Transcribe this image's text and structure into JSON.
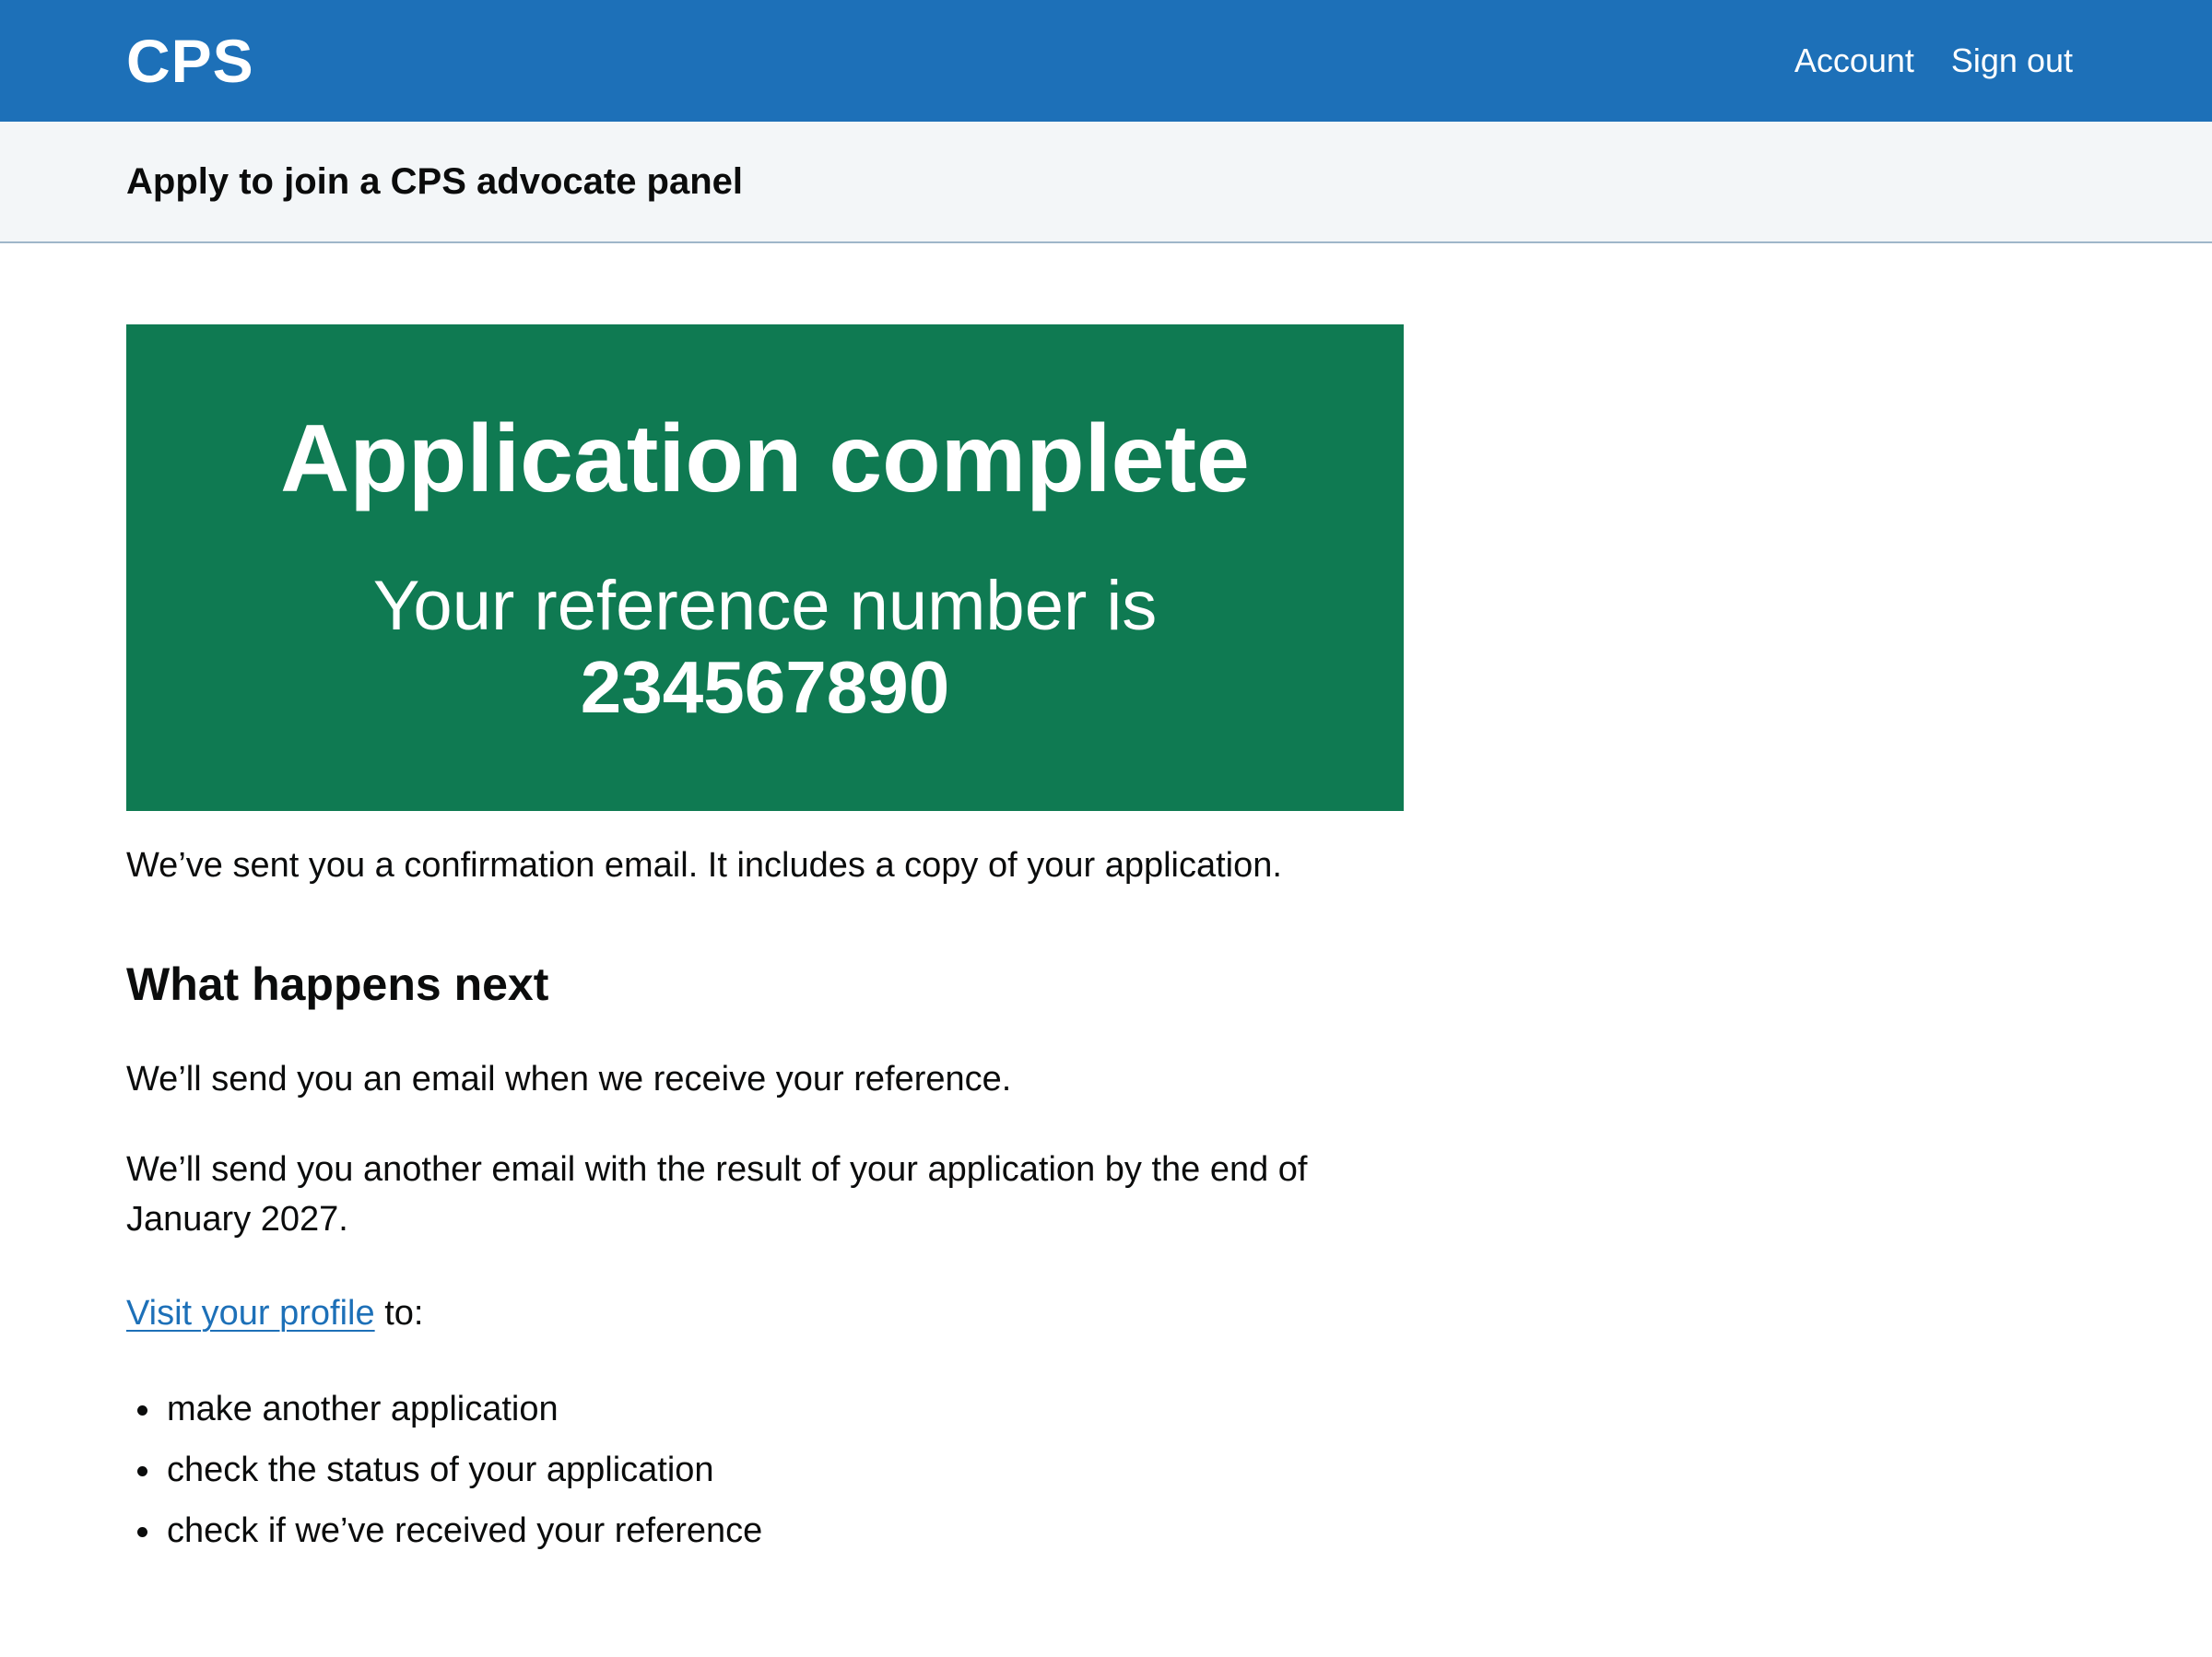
{
  "header": {
    "logo": "CPS",
    "nav": {
      "account": "Account",
      "sign_out": "Sign out"
    },
    "background_color": "#1d70b8"
  },
  "service": {
    "name": "Apply to join a CPS advocate panel"
  },
  "panel": {
    "title": "Application complete",
    "body": "Your reference number is",
    "reference": "234567890",
    "background_color": "#0f7a52"
  },
  "content": {
    "confirmation": "We’ve sent you a confirmation email. It includes a copy of your application.",
    "heading": "What happens next",
    "reference_email": "We’ll send you an email when we receive your reference.",
    "result_email": "We’ll send you another email with the result of your application by the end of January 2027.",
    "profile_link": "Visit your profile",
    "profile_suffix": " to:",
    "list": [
      "make another application",
      "check the status of your application",
      "check if we’ve received your reference"
    ],
    "link_color": "#1d70b8"
  }
}
